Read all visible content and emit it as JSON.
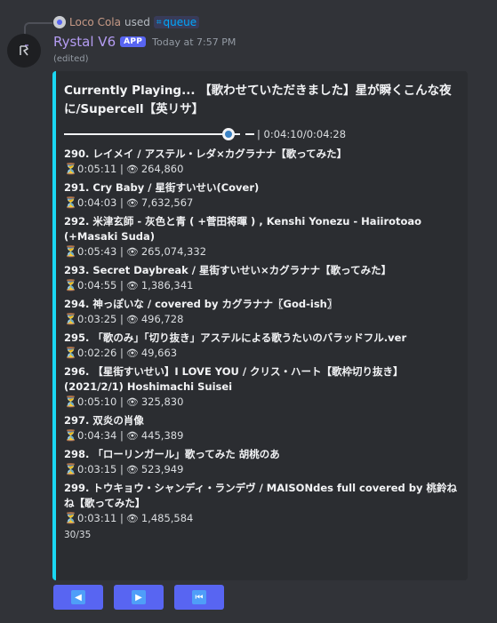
{
  "reply": {
    "user": "Loco Cola",
    "used_text": "used",
    "command": "queue",
    "command_icon": "slash-command-icon"
  },
  "message": {
    "author": "Rystal V6",
    "badge": "APP",
    "timestamp": "Today at 7:57 PM",
    "edited": "(edited)",
    "avatar_icon": "bot-avatar-icon"
  },
  "embed": {
    "accent_color": "#1ad7f2",
    "now_playing": "Currently Playing... 【歌わせていただきました】星が瞬くこんな夜に/Supercell【英リサ】",
    "progress": {
      "time_text": "| 0:04:10/0:04:28",
      "fraction": 0.933
    },
    "tracks": [
      {
        "title": "290. レイメイ / アステル・レダ×カグラナナ【歌ってみた】",
        "duration": "0:05:11",
        "views": "264,860"
      },
      {
        "title": "291. Cry Baby / 星街すいせい(Cover)",
        "duration": "0:04:03",
        "views": "7,632,567"
      },
      {
        "title": "292. 米津玄師 - 灰色と青 ( +菅田将暉 ) , Kenshi Yonezu - Haiirotoao (+Masaki Suda)",
        "duration": "0:05:43",
        "views": "265,074,332"
      },
      {
        "title": "293. Secret Daybreak / 星街すいせい×カグラナナ【歌ってみた】",
        "duration": "0:04:55",
        "views": "1,386,341"
      },
      {
        "title": "294. 神っぽいな / covered by カグラナナ〖God-ish〗",
        "duration": "0:03:25",
        "views": "496,728"
      },
      {
        "title": "295. 「歌のみ」「切り抜き」アステルによる歌うたいのバラッドフル.ver",
        "duration": "0:02:26",
        "views": "49,663"
      },
      {
        "title": "296. 【星街すいせい】I LOVE YOU / クリス・ハート【歌枠切り抜き】(2021/2/1) Hoshimachi Suisei",
        "duration": "0:05:10",
        "views": "325,830"
      },
      {
        "title": "297. 双炎の肖像",
        "duration": "0:04:34",
        "views": "445,389"
      },
      {
        "title": "298. 「ローリンガール」歌ってみた 胡桃のあ",
        "duration": "0:03:15",
        "views": "523,949"
      },
      {
        "title": "299. トウキョウ・シャンディ・ランデヴ / MAISONdes full covered by 桃鈴ねね【歌ってみた】",
        "duration": "0:03:11",
        "views": "1,485,584"
      }
    ],
    "page": "30/35"
  },
  "buttons": [
    {
      "name": "previous-page-button",
      "icon": "arrow-left-icon",
      "glyph": "◀"
    },
    {
      "name": "next-page-button",
      "icon": "arrow-right-icon",
      "glyph": "▶"
    },
    {
      "name": "first-page-button",
      "icon": "rewind-icon",
      "glyph": "⏮"
    }
  ],
  "colors": {
    "background": "#313338",
    "embed_bg": "#2b2d31",
    "button": "#5865f2",
    "username": "#b49cf2",
    "reply_user": "#c79a86"
  }
}
